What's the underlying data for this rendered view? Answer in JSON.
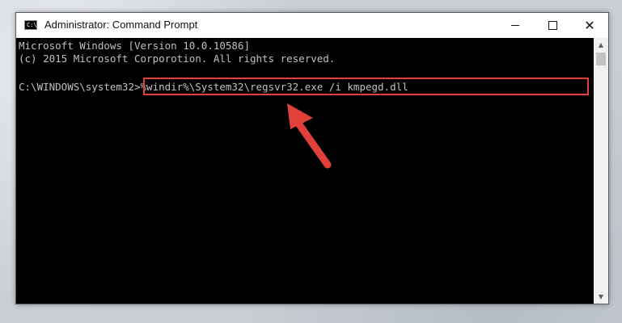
{
  "window": {
    "title": "Administrator: Command Prompt",
    "icon": "cmd-icon",
    "icon_label": "C:\\."
  },
  "controls": {
    "minimize": "minimize-icon",
    "maximize": "maximize-icon",
    "close": "✕"
  },
  "console": {
    "line1": "Microsoft Windows [Version 10.0.10586]",
    "line2": "(c) 2015 Microsoft Corporotion. All rights reserved.",
    "prompt": "C:\\WINDOWS\\system32>",
    "command": "%windir%\\System32\\regsvr32.exe /i kmpegd.dll"
  },
  "annotation": {
    "highlight_color": "#e0413b",
    "arrow_color": "#e0413b"
  },
  "scrollbar": {
    "up_glyph": "▲",
    "down_glyph": "▼"
  }
}
